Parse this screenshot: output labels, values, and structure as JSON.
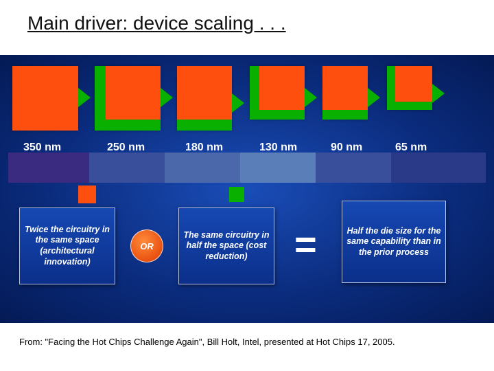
{
  "title": "Main driver: device scaling . . .",
  "nodes": [
    "350 nm",
    "250 nm",
    "180 nm",
    "130 nm",
    "90 nm",
    "65 nm"
  ],
  "eq": {
    "card1": "Twice the circuitry in the same space (architectural innovation)",
    "op": "OR",
    "card2": "The same circuitry in half the space (cost reduction)",
    "eqsign": "=",
    "card3": "Half the die size for the same capability than in the prior process"
  },
  "citation": "From: \"Facing the Hot Chips Challenge Again\", Bill Holt, Intel, presented at Hot Chips 17, 2005.",
  "colors": {
    "green": "#0ab000",
    "orange": "#ff4f0e"
  }
}
